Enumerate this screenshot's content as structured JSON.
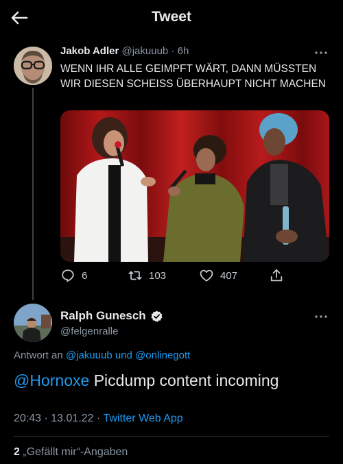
{
  "header": {
    "title": "Tweet",
    "back_icon": "arrow-left-icon"
  },
  "tweet": {
    "author_name": "Jakob Adler",
    "author_handle": "@jakuuub",
    "separator": "·",
    "time": "6h",
    "text": "WENN IHR ALLE GEIMPFT WÄRT, DANN MÜSSTEN WIR DIESEN SCHEISS ÜBERHAUPT NICHT MACHEN",
    "stats": {
      "replies": "6",
      "retweets": "103",
      "likes": "407"
    }
  },
  "reply": {
    "author_name": "Ralph Gunesch",
    "author_handle": "@felgenralle",
    "replying_prefix": "Antwort an",
    "replying_user1": "@jakuuub",
    "replying_conj": "und",
    "replying_user2": "@onlinegott",
    "mention": "@Hornoxe",
    "text": "Picdump content incoming",
    "time": "20:43",
    "date": "13.01.22",
    "meta_sep": "·",
    "client": "Twitter Web App",
    "likes_count": "2",
    "likes_label": "„Gefällt mir“-Angaben"
  },
  "colors": {
    "background": "#000000",
    "accent": "#1d9bf0",
    "muted": "#8b98a5",
    "text": "#e7e9ea"
  }
}
